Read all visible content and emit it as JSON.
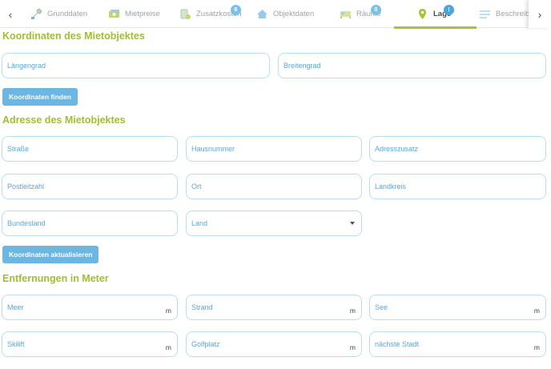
{
  "tabs": [
    {
      "label": "Grunddaten",
      "icon": "wrench-icon"
    },
    {
      "label": "Mietpreise",
      "icon": "money-icon"
    },
    {
      "label": "Zusatzkosten",
      "icon": "coins-icon",
      "badge": "6"
    },
    {
      "label": "Objektdaten",
      "icon": "house-icon"
    },
    {
      "label": "Räume",
      "icon": "bed-icon",
      "badge": "0"
    },
    {
      "label": "Lage",
      "icon": "location-pin-icon",
      "badge": "!"
    },
    {
      "label": "Beschreibu",
      "icon": "text-lines-icon"
    }
  ],
  "coordinates": {
    "title": "Koordinaten des Mietobjektes",
    "longitude_label": "Längengrad",
    "latitude_label": "Breitengrad",
    "find_button": "Koordinaten finden"
  },
  "address": {
    "title": "Adresse des Mietobjektes",
    "street": "Straße",
    "house_number": "Hausnummer",
    "address_suffix": "Adresszusatz",
    "postal_code": "Postleitzahl",
    "city": "Ort",
    "district": "Landkreis",
    "state": "Bundesland",
    "country": "Land",
    "update_button": "Koordinaten aktualisieren"
  },
  "distances": {
    "title": "Entfernungen in Meter",
    "unit": "m",
    "sea": "Meer",
    "beach": "Strand",
    "lake": "See",
    "ski_lift": "Skilift",
    "golf_course": "Golfplatz",
    "nearest_city": "nächste Stadt"
  },
  "colors": {
    "accent_green": "#a3bd32",
    "field_border": "#b7def2",
    "label_blue": "#5ba7d6",
    "button_blue": "#6bb6e3",
    "badge_blue": "#7cc0e6"
  }
}
